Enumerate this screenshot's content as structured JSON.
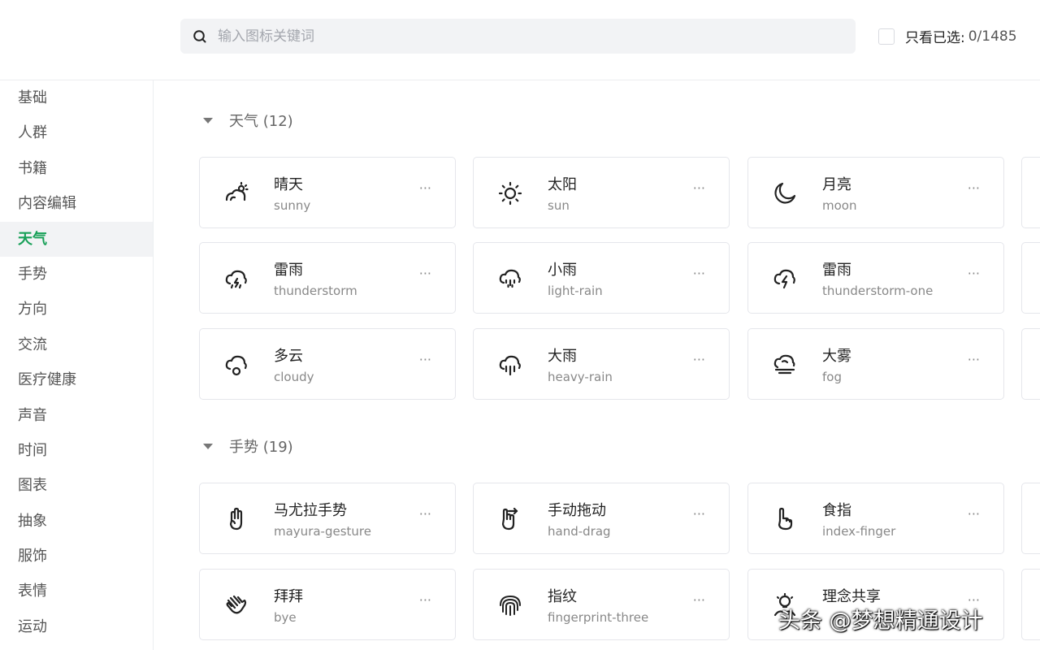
{
  "search": {
    "placeholder": "输入图标关键词"
  },
  "filter": {
    "label": "只看已选:",
    "count": "0/1485"
  },
  "sidebar": {
    "items": [
      {
        "label": "基础"
      },
      {
        "label": "人群"
      },
      {
        "label": "书籍"
      },
      {
        "label": "内容编辑"
      },
      {
        "label": "天气",
        "active": true
      },
      {
        "label": "手势"
      },
      {
        "label": "方向"
      },
      {
        "label": "交流"
      },
      {
        "label": "医疗健康"
      },
      {
        "label": "声音"
      },
      {
        "label": "时间"
      },
      {
        "label": "图表"
      },
      {
        "label": "抽象"
      },
      {
        "label": "服饰"
      },
      {
        "label": "表情"
      },
      {
        "label": "运动"
      }
    ]
  },
  "sections": [
    {
      "title": "天气 (12)",
      "cards": [
        {
          "name": "晴天",
          "key": "sunny",
          "icon": "sunny-icon"
        },
        {
          "name": "太阳",
          "key": "sun",
          "icon": "sun-icon"
        },
        {
          "name": "月亮",
          "key": "moon",
          "icon": "moon-icon"
        },
        {
          "name": "雷雨",
          "key": "thunderstorm",
          "icon": "thunderstorm-icon"
        },
        {
          "name": "小雨",
          "key": "light-rain",
          "icon": "light-rain-icon"
        },
        {
          "name": "雷雨",
          "key": "thunderstorm-one",
          "icon": "thunderstorm-one-icon"
        },
        {
          "name": "多云",
          "key": "cloudy",
          "icon": "cloudy-icon"
        },
        {
          "name": "大雨",
          "key": "heavy-rain",
          "icon": "heavy-rain-icon"
        },
        {
          "name": "大雾",
          "key": "fog",
          "icon": "fog-icon"
        }
      ]
    },
    {
      "title": "手势 (19)",
      "cards": [
        {
          "name": "马尤拉手势",
          "key": "mayura-gesture",
          "icon": "mayura-gesture-icon"
        },
        {
          "name": "手动拖动",
          "key": "hand-drag",
          "icon": "hand-drag-icon"
        },
        {
          "name": "食指",
          "key": "index-finger",
          "icon": "index-finger-icon"
        },
        {
          "name": "拜拜",
          "key": "bye",
          "icon": "bye-icon"
        },
        {
          "name": "指纹",
          "key": "fingerprint-three",
          "icon": "fingerprint-three-icon"
        },
        {
          "name": "理念共享",
          "key": "",
          "icon": "idea-sharing-icon"
        }
      ]
    }
  ],
  "more_label": "···",
  "watermark": "头条 @梦想精通设计",
  "colors": {
    "accent": "#18a058",
    "card_border": "#e5e6eb",
    "sidebar_active_bg": "#f2f3f5"
  }
}
